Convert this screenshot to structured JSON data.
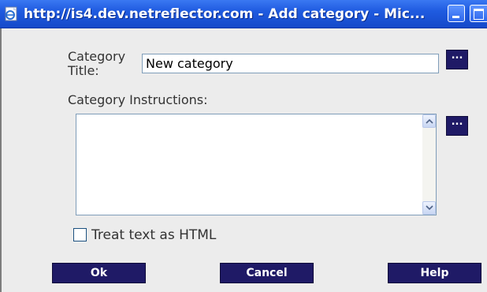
{
  "window": {
    "title": "http://is4.dev.netreflector.com - Add category - Mic...",
    "icon": "ie-page-icon"
  },
  "form": {
    "category_title_label": "Category Title:",
    "category_title_value": "New category",
    "instructions_label": "Category Instructions:",
    "instructions_value": "",
    "ellipsis_label": "...",
    "treat_as_html_label": "Treat text as HTML",
    "treat_as_html_checked": false
  },
  "buttons": {
    "ok": "Ok",
    "cancel": "Cancel",
    "help": "Help"
  },
  "colors": {
    "titlebar": "#1f5be0",
    "button_bg": "#1f1a66",
    "dialog_bg": "#ececec"
  }
}
